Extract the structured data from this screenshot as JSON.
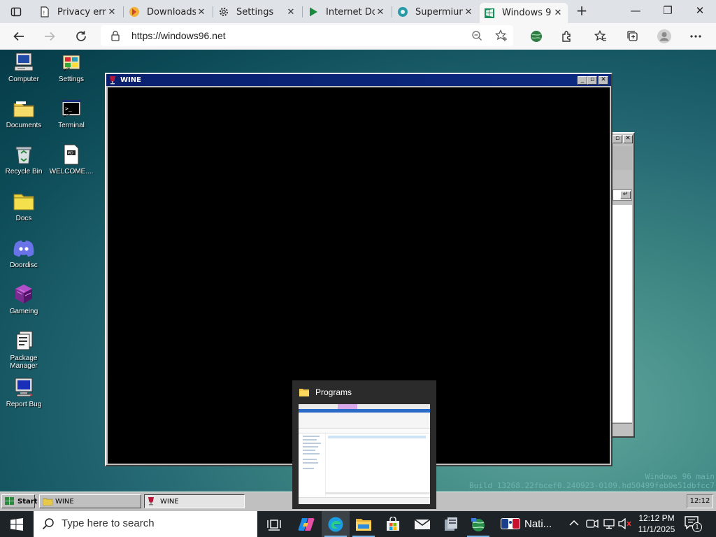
{
  "browser": {
    "tabs": [
      {
        "title": "Privacy erro",
        "icon": "document-icon",
        "close": "✕"
      },
      {
        "title": "Downloads",
        "icon": "downloads-icon",
        "close": "✕"
      },
      {
        "title": "Settings",
        "icon": "gear-icon",
        "close": "✕"
      },
      {
        "title": "Internet Do",
        "icon": "play-icon",
        "close": "✕"
      },
      {
        "title": "Supermium",
        "icon": "supermium-icon",
        "close": "✕"
      },
      {
        "title": "Windows 9",
        "icon": "windows96-icon",
        "close": "✕",
        "active": true
      }
    ],
    "new_tab": "+",
    "url": "https://windows96.net",
    "window_buttons": {
      "minimize": "—",
      "restore": "❐",
      "close": "✕"
    }
  },
  "desktop": {
    "icons_col1": [
      {
        "label": "Computer",
        "icon": "computer-icon"
      },
      {
        "label": "Documents",
        "icon": "folder-icon"
      },
      {
        "label": "Recycle Bin",
        "icon": "recycle-bin-icon"
      },
      {
        "label": "Docs",
        "icon": "folder-icon"
      },
      {
        "label": "Doordisc",
        "icon": "discord-icon"
      },
      {
        "label": "Gameing",
        "icon": "game-cube-icon"
      },
      {
        "label": "Package Manager",
        "icon": "package-icon"
      },
      {
        "label": "Report Bug",
        "icon": "monitor-icon"
      }
    ],
    "icons_col2": [
      {
        "label": "Settings",
        "icon": "settings-icon"
      },
      {
        "label": "Terminal",
        "icon": "terminal-icon"
      },
      {
        "label": "WELCOME....",
        "icon": "text-file-icon"
      }
    ],
    "wine_window": {
      "title": "WINE"
    },
    "watermark": {
      "line1": "Windows 96 main",
      "line2": "Build 13268.22fbcef0.240923-0109.hd50499feb0e51dbfcc7"
    },
    "programs_preview": {
      "title": "Programs"
    }
  },
  "w96_taskbar": {
    "start_label": "Start",
    "tasks": [
      {
        "label": "WINE",
        "icon": "folder-icon"
      },
      {
        "label": "WINE",
        "icon": "wine-icon"
      }
    ],
    "clock": "12:12"
  },
  "win_taskbar": {
    "search_placeholder": "Type here to search",
    "weather_label": "Nati...",
    "time": "12:12 PM",
    "date": "11/1/2025",
    "notification_count": "1"
  },
  "colors": {
    "w96_title": "#0b2a80",
    "tab_strip": "#dfe3e8",
    "desktop_teal": "#3f8884",
    "taskbar": "#1d2327"
  }
}
